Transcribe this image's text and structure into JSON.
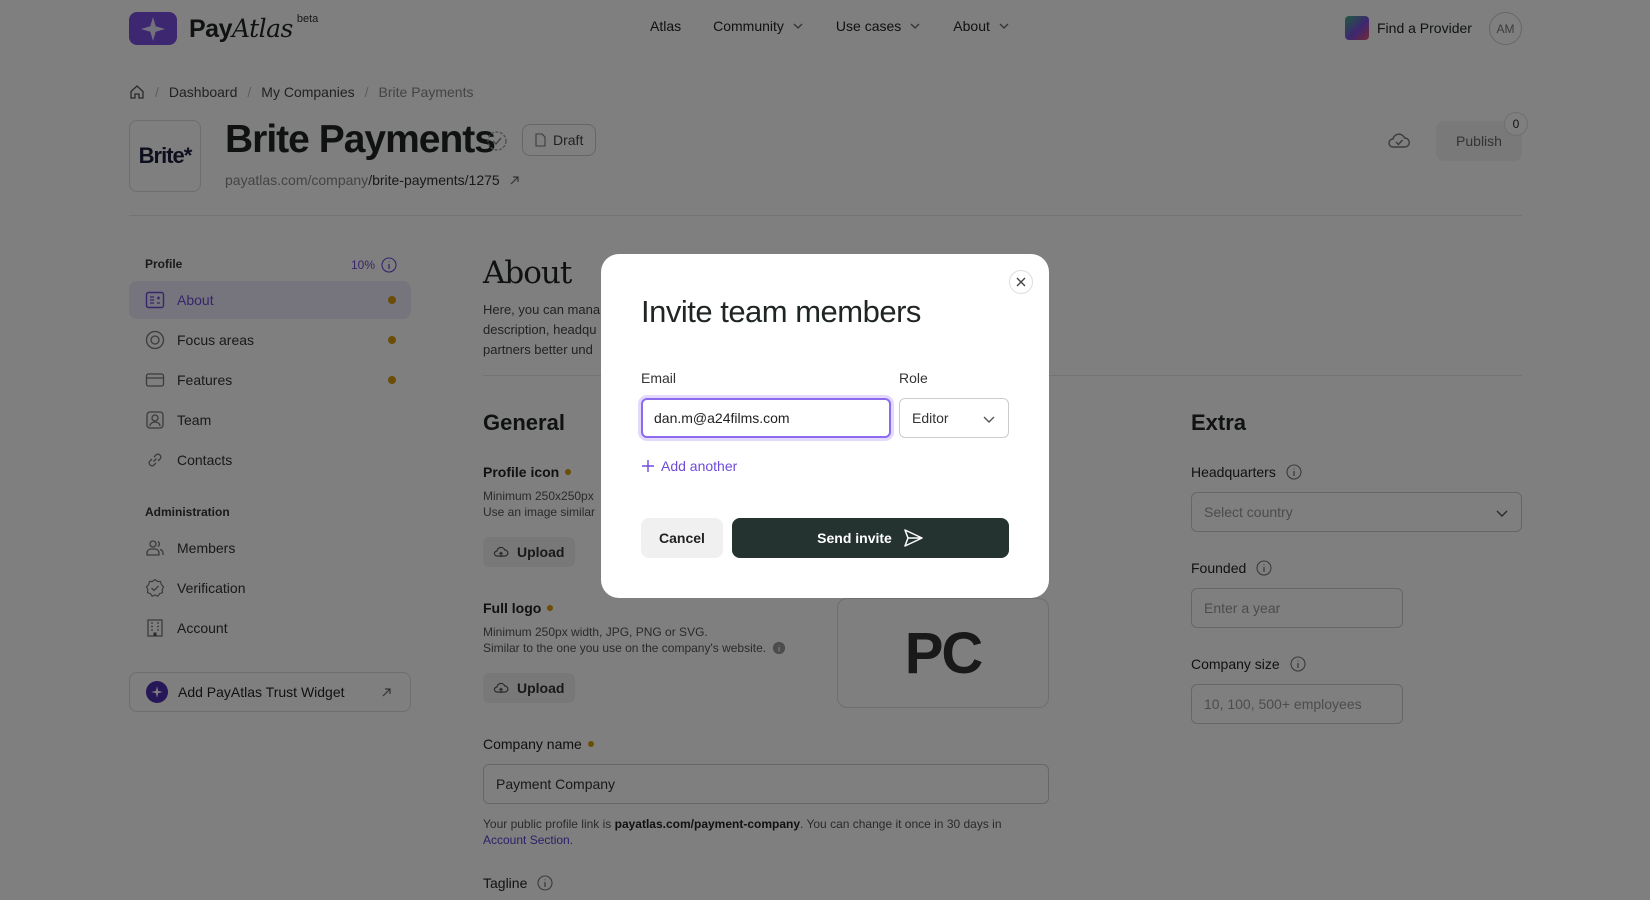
{
  "header": {
    "brand": "Pay",
    "brand_italic": "Atlas",
    "beta": "beta",
    "nav": [
      {
        "label": "Atlas"
      },
      {
        "label": "Community"
      },
      {
        "label": "Use cases"
      },
      {
        "label": "About"
      }
    ],
    "find_provider": "Find a Provider",
    "avatar": "AM"
  },
  "breadcrumb": [
    "Dashboard",
    "My Companies",
    "Brite Payments"
  ],
  "company": {
    "logo_text": "Brite*",
    "name": "Brite Payments",
    "status": "Draft",
    "url_prefix": "payatlas.com/company",
    "url_path": "/brite-payments/1275",
    "publish_label": "Publish",
    "publish_count": "0"
  },
  "sidebar": {
    "profile_heading": "Profile",
    "progress": "10%",
    "profile_items": [
      {
        "label": "About",
        "icon": "id-card-icon",
        "pending": true,
        "active": true
      },
      {
        "label": "Focus areas",
        "icon": "target-icon",
        "pending": true
      },
      {
        "label": "Features",
        "icon": "card-icon",
        "pending": true
      },
      {
        "label": "Team",
        "icon": "user-icon",
        "pending": false
      },
      {
        "label": "Contacts",
        "icon": "link-icon",
        "pending": false
      }
    ],
    "admin_heading": "Administration",
    "admin_items": [
      {
        "label": "Members",
        "icon": "users-icon"
      },
      {
        "label": "Verification",
        "icon": "badge-check-icon"
      },
      {
        "label": "Account",
        "icon": "building-icon"
      }
    ],
    "widget_button": "Add PayAtlas Trust Widget"
  },
  "main": {
    "title": "About",
    "description_lines": [
      "Here, you can mana",
      "description, headqu",
      "partners better und"
    ],
    "general_title": "General",
    "profile_icon_label": "Profile icon",
    "profile_icon_hints": [
      "Minimum 250x250px",
      "Use an image similar"
    ],
    "upload_label": "Upload",
    "full_logo_label": "Full logo",
    "full_logo_hints": [
      "Minimum 250px width, JPG, PNG or SVG.",
      "Similar to the one you use on the company's website."
    ],
    "logo_preview": "PC",
    "company_name_label": "Company name",
    "company_name_value": "Payment Company",
    "note_prefix": "Your public profile link is ",
    "note_link": "payatlas.com/payment-company",
    "note_mid": ". You can change it once in 30 days in",
    "note_account": "Account Section",
    "note_end": ".",
    "tagline_label": "Tagline",
    "extra_title": "Extra",
    "hq_label": "Headquarters",
    "hq_placeholder": "Select country",
    "founded_label": "Founded",
    "founded_placeholder": "Enter a year",
    "size_label": "Company size",
    "size_placeholder": "10, 100, 500+ employees"
  },
  "modal": {
    "title": "Invite team members",
    "email_label": "Email",
    "role_label": "Role",
    "email_value": "dan.m@a24films.com",
    "role_value": "Editor",
    "add_another": "Add another",
    "cancel": "Cancel",
    "send": "Send invite"
  },
  "colors": {
    "accent": "#6e4bd8",
    "pending_dot": "#d79a0c",
    "primary_button": "#243330"
  }
}
